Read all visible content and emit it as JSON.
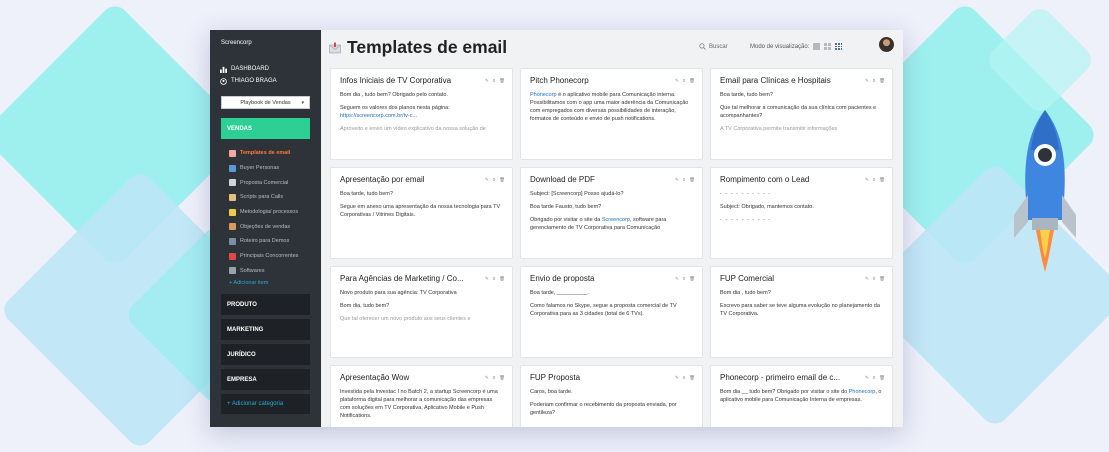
{
  "colors": {
    "sidebar": "#2d3338",
    "vendas_active": "#2ecf94",
    "active_item": "#ff7a3c",
    "link": "#28a9d8"
  },
  "sidebar": {
    "brand": "Screencorp",
    "nav": [
      {
        "label": "DASHBOARD",
        "icon": "bar-chart-icon"
      },
      {
        "label": "THIAGO BRAGA",
        "icon": "user-circle-icon"
      }
    ],
    "playbook_select": "Playbook de Vendas",
    "vendas_label": "VENDAS",
    "vendas_items": [
      {
        "label": "Templates de email",
        "active": true,
        "color": "#f4a8a0"
      },
      {
        "label": "Buyer Personas",
        "color": "#5b9bd5"
      },
      {
        "label": "Proposta Comercial",
        "color": "#cfd4da"
      },
      {
        "label": "Scripts para Calls",
        "color": "#e5c07b"
      },
      {
        "label": "Metodologia/ processos",
        "color": "#f0c84b"
      },
      {
        "label": "Objeções de vendas",
        "color": "#d99a5b"
      },
      {
        "label": "Roteiro para Demos",
        "color": "#7a8fa6"
      },
      {
        "label": "Principais Concorrentes",
        "color": "#e04848"
      },
      {
        "label": "Softwares",
        "color": "#9aa3ad"
      }
    ],
    "add_item": "+ Adicionar item",
    "categories": [
      "PRODUTO",
      "MARKETING",
      "JURÍDICO",
      "EMPRESA"
    ],
    "add_category": "+ Adicionar categoria"
  },
  "header": {
    "title": "Templates de email",
    "search": "Buscar",
    "view_mode": "Modo de visualização:"
  },
  "cards": [
    {
      "title": "Infos Iniciais de TV Corporativa",
      "likes": "0",
      "lines": [
        {
          "t": "Bom dia , tudo bem?  Obrigado pelo contato."
        },
        {
          "t": "Seguem os valores dos planos nesta página: ",
          "link": "https://screencorp.com.br/tv-c..."
        },
        {
          "t": "Aproveito e envio um vídeo explicativo da nossa solução de",
          "fade": true
        }
      ]
    },
    {
      "title": "Pitch Phonecorp",
      "likes": "0",
      "lines": [
        {
          "link": "Phonecorp",
          "t": " é o aplicativo mobile para Comunicação interna. Possibilitamos com o app uma maior aderência da Comunicação com empregados com diversas possibilidades de interação, formatos de conteúdo e envio de push notifications."
        }
      ]
    },
    {
      "title": "Email para Clínicas e Hospitais",
      "likes": "0",
      "lines": [
        {
          "t": "Boa tarde, tudo bem?"
        },
        {
          "t": "Que tal melhorar a comunicação da sua clínica com pacientes e acompanhantes?"
        },
        {
          "t": "A TV Corporativa permite transmitir informações",
          "fade": true
        }
      ]
    },
    {
      "title": "Apresentação por email",
      "likes": "0",
      "lines": [
        {
          "t": "Boa tarde, tudo bem?"
        },
        {
          "t": "Segue em anexo uma apresentação da nossa tecnologia para TV Corporativas / Vitrines Digitais."
        }
      ]
    },
    {
      "title": "Download de PDF",
      "likes": "0",
      "lines": [
        {
          "t": "Subject: [Screencorp] Posso ajudá-lo?"
        },
        {
          "t": "Boa tarde Fausto, tudo bem?"
        },
        {
          "t": "Obrigado por visitar o site da ",
          "link": "Screencorp",
          "t2": ", software para gerenciamento de TV Corporativa para Comunicação"
        }
      ]
    },
    {
      "title": "Rompimento com o Lead",
      "likes": "0",
      "lines": [
        {
          "t": "- - - - - - - - - -",
          "dash": true
        },
        {
          "t": "Subject: Obrigado, mantemos contato."
        },
        {
          "t": "- - - - - - - - - -",
          "dash": true
        }
      ]
    },
    {
      "title": "Para Agências de Marketing / Co...",
      "likes": "0",
      "lines": [
        {
          "t": "Novo produto para sua agência: TV Corporativa"
        },
        {
          "t": "Bom dia, tudo bem?"
        },
        {
          "t": "Que tal oferecer um novo produto aos seus clientes e",
          "fade": true
        }
      ]
    },
    {
      "title": "Envio de proposta",
      "likes": "0",
      "lines": [
        {
          "t": "Boa tarde, __________."
        },
        {
          "t": "Como falamos no Skype, segue a proposta comercial de TV Corporativa para as 3 cidades (total de 6 TVs)."
        }
      ]
    },
    {
      "title": "FUP Comercial",
      "likes": "0",
      "lines": [
        {
          "t": "Bom dia , tudo bem?"
        },
        {
          "t": "Escrevo para saber se teve alguma evolução no planejamento da TV Corporativa."
        }
      ]
    },
    {
      "title": "Apresentação Wow",
      "likes": "0",
      "lines": [
        {
          "t": "Investida pela Investac I no Batch 2, a startup Screencorp é uma plataforma digital para melhorar a comunicação das empresas com soluções em TV Corporativa, Aplicativo Mobile e Push Notifications."
        }
      ]
    },
    {
      "title": "FUP Proposta",
      "likes": "0",
      "lines": [
        {
          "t": "Caros, boa tarde."
        },
        {
          "t": "Poderiam confirmar o recebimento da proposta enviada, por gentileza?"
        }
      ]
    },
    {
      "title": "Phonecorp - primeiro email de c...",
      "likes": "0",
      "lines": [
        {
          "t": "Bom dia __ tudo bem? Obrigado por visitar o site do ",
          "link": "Phonecorp",
          "t2": ", o aplicativo mobile para Comunicação Interna de empresas."
        }
      ]
    }
  ]
}
